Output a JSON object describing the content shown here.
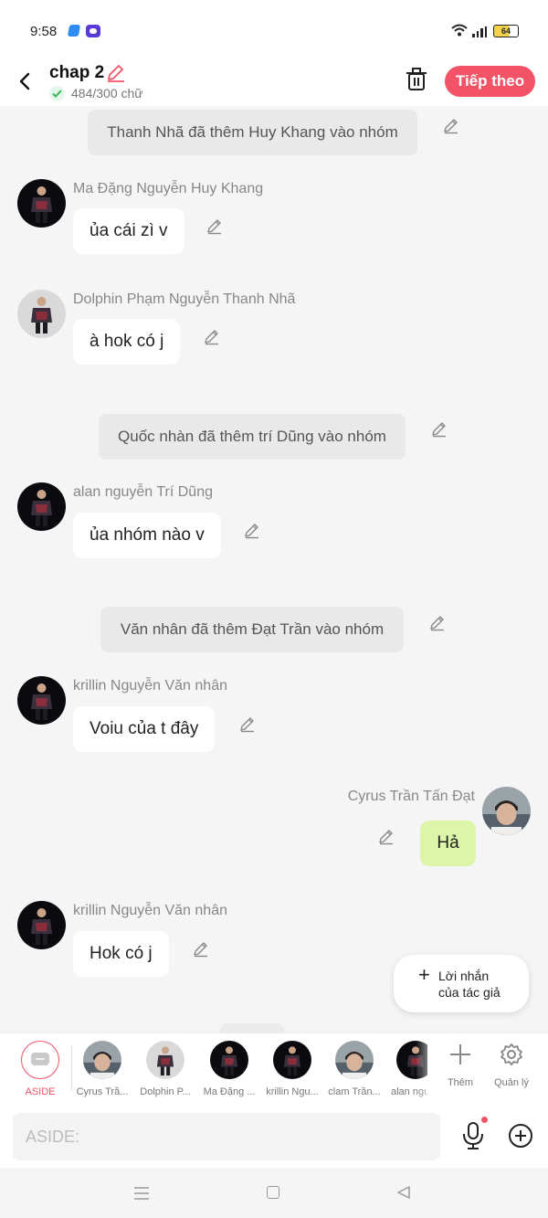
{
  "status_bar": {
    "time": "9:58",
    "battery": "64"
  },
  "header": {
    "title": "chap 2",
    "count": "484/300 chữ",
    "next_label": "Tiếp theo"
  },
  "chat": {
    "system_messages": [
      "Thanh Nhã đã thêm Huy Khang vào nhóm",
      "Quốc nhàn đã thêm trí Dũng vào nhóm",
      "Văn nhân đã thêm Đạt Trần vào nhóm"
    ],
    "messages": [
      {
        "sender": "Ma Đặng Nguyễn Huy Khang",
        "text": "ủa cái zì v"
      },
      {
        "sender": "Dolphin Phạm Nguyễn Thanh Nhã",
        "text": "à hok có j"
      },
      {
        "sender": "alan nguyễn Trí Dũng",
        "text": "ủa nhóm nào v"
      },
      {
        "sender": "krillin Nguyễn Văn nhân",
        "text": "Voiu của t đây"
      },
      {
        "sender": "Cyrus Trần Tấn Đạt",
        "text": "Hả"
      },
      {
        "sender": "krillin Nguyễn Văn nhân",
        "text": "Hok có j"
      }
    ],
    "author_note": {
      "line1": "Lời nhắn",
      "line2": "của tác giả"
    }
  },
  "characters": [
    {
      "name": "ASIDE"
    },
    {
      "name": "Cyrus Trầ..."
    },
    {
      "name": "Dolphin P..."
    },
    {
      "name": "Ma Đặng ..."
    },
    {
      "name": "krillin Ngu..."
    },
    {
      "name": "clam Trần..."
    },
    {
      "name": "alan ngu"
    }
  ],
  "tools": {
    "add_label": "Thêm",
    "manage_label": "Quản lý"
  },
  "input": {
    "placeholder": "ASIDE:"
  },
  "colors": {
    "accent": "#f25367",
    "my_bubble": "#dcf5a8",
    "system_bubble": "#e9e9e9",
    "background": "#f5f5f5"
  },
  "icons": [
    "back-arrow-icon",
    "pencil-icon",
    "check-icon",
    "trash-icon",
    "plus-icon",
    "gear-icon",
    "microphone-icon",
    "add-circle-icon"
  ]
}
